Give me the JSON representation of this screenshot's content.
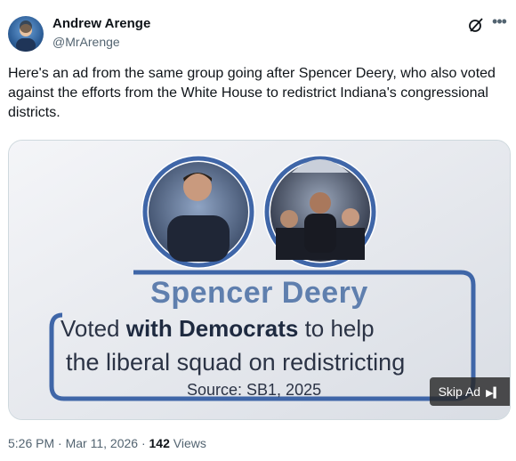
{
  "author": {
    "name": "Andrew Arenge",
    "handle": "@MrArenge"
  },
  "tweet": {
    "text": "Here's an ad from the same group going after Spencer Deery, who also voted against the efforts from the White House to redistrict Indiana's congressional districts."
  },
  "video": {
    "headline": "Spencer Deery",
    "line1_pre": "Voted ",
    "line1_bold": "with Democrats",
    "line1_post": " to help",
    "line2": "the liberal squad on redistricting",
    "source": "Source: SB1, 2025",
    "skip_label": "Skip Ad"
  },
  "meta": {
    "time": "5:26 PM",
    "sep1": " · ",
    "date": "Mar 11, 2026",
    "sep2": " · ",
    "views_count": "142",
    "views_label": " Views"
  },
  "icons": {
    "grok": "grok-icon",
    "more": "more-icon",
    "skip": "skip-next-icon"
  },
  "colors": {
    "headline": "#5f7fae",
    "frame_blue": "#3f66a8",
    "meta_gray": "#536471"
  }
}
